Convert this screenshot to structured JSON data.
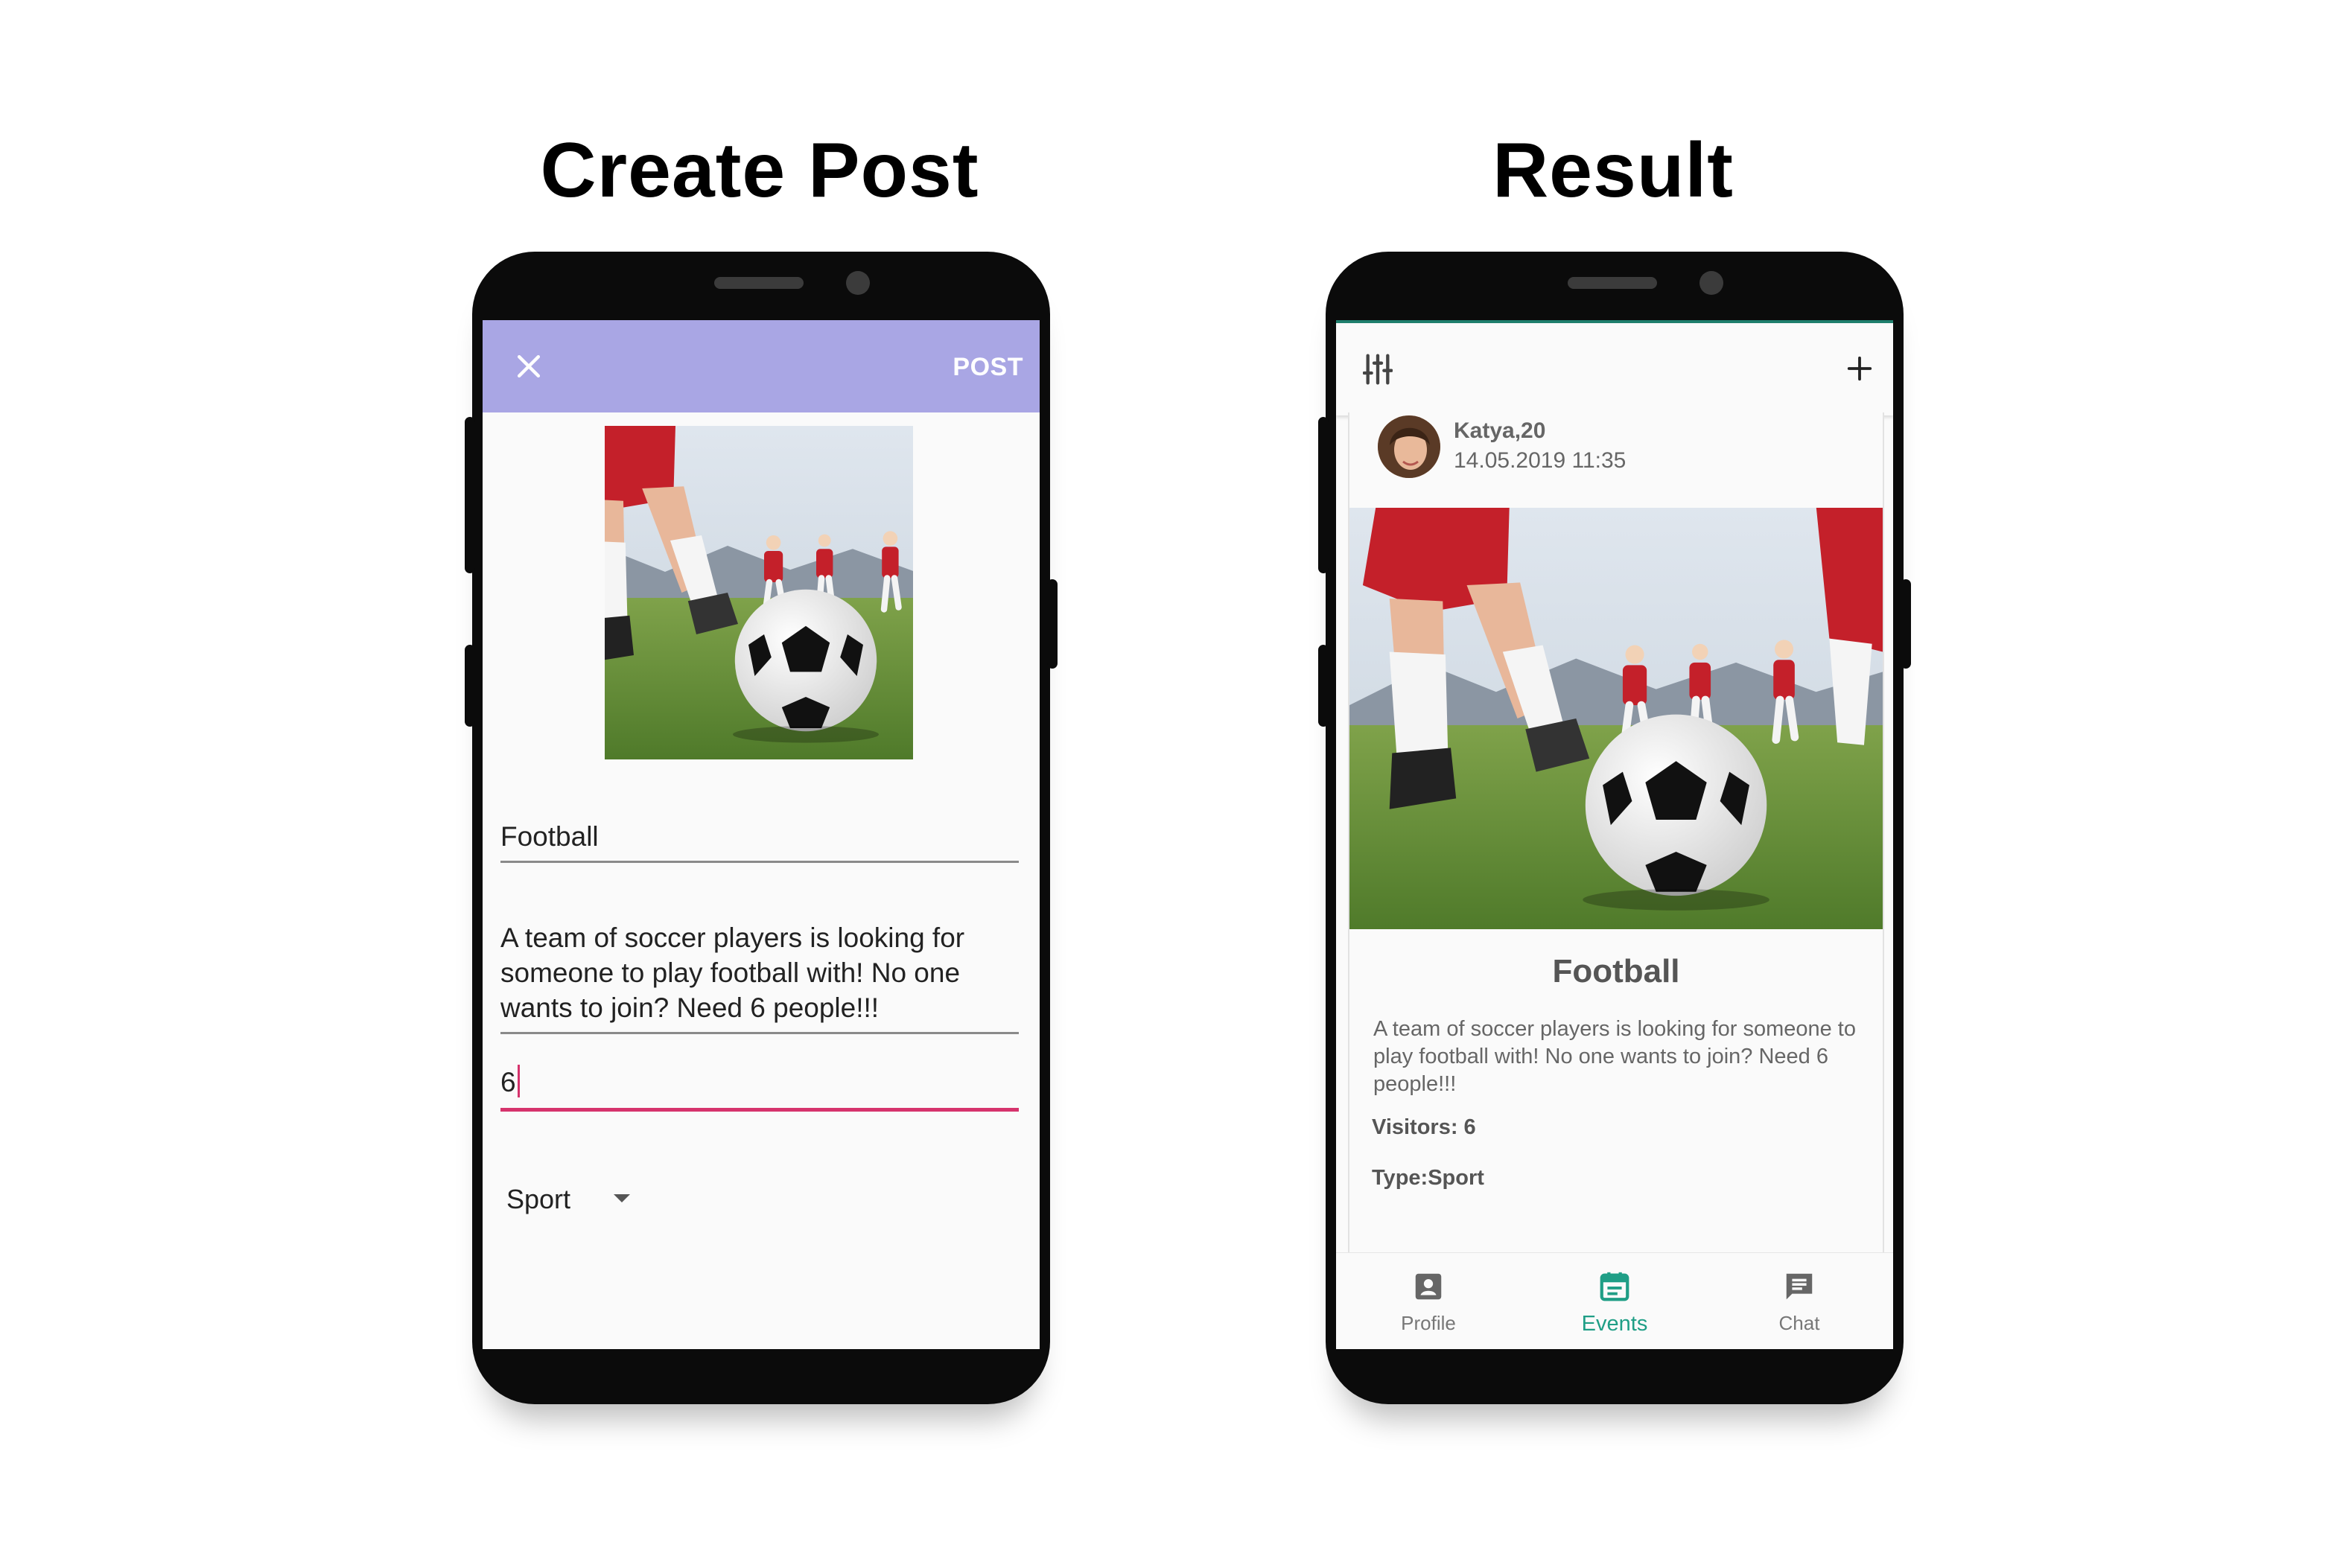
{
  "left_panel": {
    "title": "Create Post",
    "toolbar": {
      "post_label": "POST"
    },
    "form": {
      "title_value": "Football",
      "description_value": "A team of soccer players is looking for someone to play football with! No one wants to join? Need 6 people!!!",
      "visitors_value": "6",
      "type_value": "Sport"
    }
  },
  "right_panel": {
    "title": "Result",
    "post": {
      "user": "Katya,20",
      "date": "14.05.2019 11:35",
      "title": "Football",
      "description": "A team of soccer players is looking for someone to play football with! No one wants to join? Need 6 people!!!",
      "visitors": "Visitors: 6",
      "type": "Type:Sport"
    },
    "nav": [
      {
        "label": "Profile",
        "active": false
      },
      {
        "label": "Events",
        "active": true
      },
      {
        "label": "Chat",
        "active": false
      }
    ]
  },
  "colors": {
    "create_toolbar": "#a9a6e4",
    "active_input": "#d6336c",
    "nav_active": "#1f9e86",
    "status_bar_line": "#1f7f6d"
  },
  "icons": [
    "close-icon",
    "filter-icon",
    "plus-icon",
    "profile-icon",
    "events-icon",
    "chat-icon",
    "dropdown-arrow-icon"
  ]
}
